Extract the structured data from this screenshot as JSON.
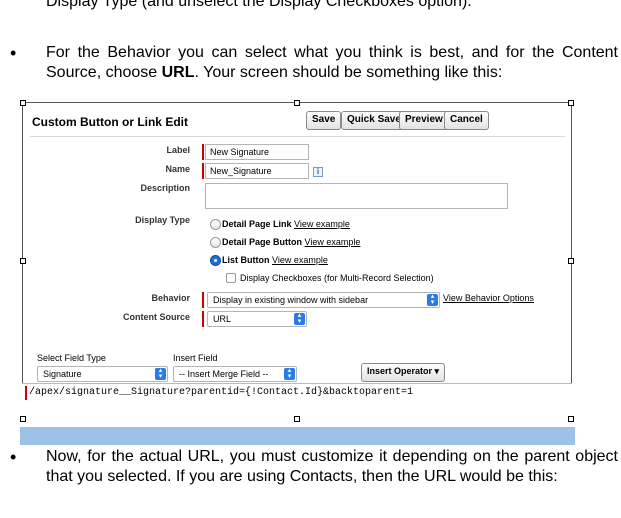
{
  "doc": {
    "top_partial": "Display Type (and unselect the Display Checkboxes option).",
    "bullet_symbol": "•",
    "para1_a": "For the Behavior you can select what you think is best, and for the Content Source, choose ",
    "para1_bold": "URL",
    "para1_b": ".  Your screen should be something like this:",
    "para2": "Now, for the actual URL, you must customize it depending on the parent object that you selected.  If you are using Contacts, then the URL would be this:"
  },
  "screenshot": {
    "title": "Custom Button or Link Edit",
    "buttons": [
      "Save",
      "Quick Save",
      "Preview",
      "Cancel"
    ],
    "labels": {
      "label": "Label",
      "name": "Name",
      "description": "Description",
      "display_type": "Display Type",
      "behavior": "Behavior",
      "content_source": "Content Source"
    },
    "values": {
      "label": "New Signature",
      "name": "New_Signature",
      "description": ""
    },
    "display_options": [
      {
        "label": "Detail Page Link",
        "link": "View example",
        "selected": false
      },
      {
        "label": "Detail Page Button",
        "link": "View example",
        "selected": false
      },
      {
        "label": "List Button",
        "link": "View example",
        "selected": true
      }
    ],
    "checkbox_label": "Display Checkboxes (for Multi-Record Selection)",
    "behavior_value": "Display in existing window with sidebar",
    "behavior_link": "View Behavior Options",
    "content_source_value": "URL",
    "select_field_type_label": "Select Field Type",
    "select_field_type_value": "Signature",
    "insert_field_label": "Insert Field",
    "insert_field_value": "-- Insert Merge Field --",
    "insert_operator": "Insert Operator",
    "url": "/apex/signature__Signature?parentid={!Contact.Id}&backtoparent=1",
    "info_icon_text": "i"
  },
  "colors": {
    "required": "#cc0000",
    "frame_blue": "#9cc3e6",
    "select_arrow": "#2a7be4"
  },
  "icons": [
    "info-icon",
    "select-arrow-icon",
    "dropdown-triangle-icon",
    "radio-icon",
    "checkbox-icon"
  ]
}
